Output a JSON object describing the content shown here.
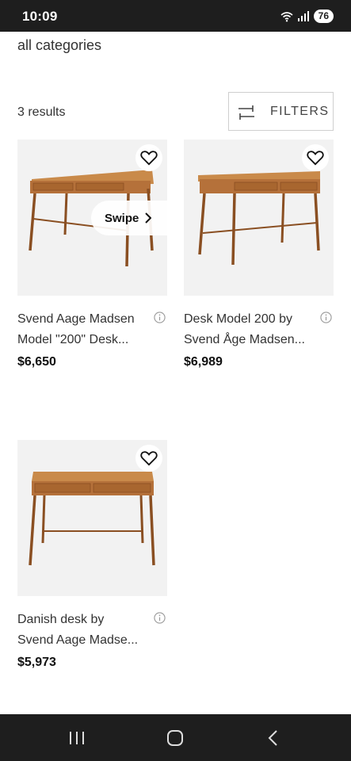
{
  "status_bar": {
    "time": "10:09",
    "battery": "76"
  },
  "breadcrumb": "all categories",
  "results": {
    "count_label": "3 results",
    "filters_label": "FILTERS"
  },
  "products": [
    {
      "title_line1": "Svend Aage Madsen",
      "title_line2": "Model \"200\" Desk...",
      "price": "$6,650",
      "swipe_label": "Swipe"
    },
    {
      "title_line1": "Desk Model 200 by",
      "title_line2": "Svend Åge Madsen...",
      "price": "$6,989"
    },
    {
      "title_line1": "Danish desk by",
      "title_line2": "Svend Aage Madse...",
      "price": "$5,973"
    }
  ],
  "icons": {
    "favorite": "heart-outline-icon",
    "info": "info-circle-icon",
    "filters": "sliders-icon",
    "nav": [
      "recent-apps-icon",
      "home-icon",
      "back-icon"
    ]
  }
}
